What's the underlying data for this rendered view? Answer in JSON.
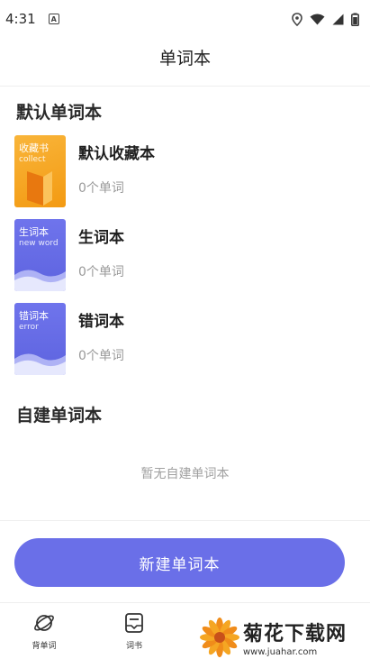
{
  "status": {
    "time": "4:31",
    "notification_letter": "A"
  },
  "header": {
    "title": "单词本"
  },
  "default_section": {
    "title": "默认单词本",
    "books": [
      {
        "cover_title": "收藏书",
        "cover_sub": "collect",
        "name": "默认收藏本",
        "count": "0个单词",
        "cover_color": "#f5a623"
      },
      {
        "cover_title": "生词本",
        "cover_sub": "new word",
        "name": "生词本",
        "count": "0个单词",
        "cover_color": "#6a6fe8"
      },
      {
        "cover_title": "错词本",
        "cover_sub": "error",
        "name": "错词本",
        "count": "0个单词",
        "cover_color": "#6a6fe8"
      }
    ]
  },
  "custom_section": {
    "title": "自建单词本",
    "empty_text": "暂无自建单词本"
  },
  "new_button": {
    "label": "新建单词本"
  },
  "nav": {
    "items": [
      {
        "label": "背单词",
        "icon": "planet-icon"
      },
      {
        "label": "词书",
        "icon": "book-icon"
      }
    ]
  },
  "watermark": {
    "title": "菊花下载网",
    "url": "www.juahar.com"
  },
  "colors": {
    "accent": "#6a6fe8",
    "collect": "#f5a623"
  }
}
